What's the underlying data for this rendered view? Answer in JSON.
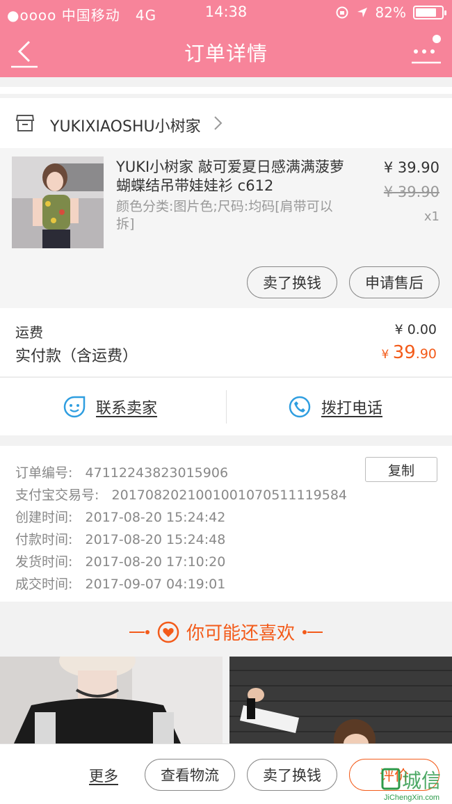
{
  "status_bar": {
    "signal": "●oooo 中国移动",
    "network": "4G",
    "time": "14:38",
    "battery": "82%"
  },
  "nav": {
    "title": "订单详情"
  },
  "shop": {
    "name": "YUKIXIAOSHU小树家"
  },
  "item": {
    "title": "YUKI小树家 敲可爱夏日感满满菠萝蝴蝶结吊带娃娃衫 c612",
    "spec": "颜色分类:图片色;尺码:均码[肩带可以拆]",
    "price": "¥ 39.90",
    "original_price": "¥ 39.90",
    "quantity": "x1",
    "actions": [
      "卖了换钱",
      "申请售后"
    ]
  },
  "fees": {
    "shipping_label": "运费",
    "shipping_value": "¥ 0.00",
    "paid_label": "实付款（含运费）",
    "paid_currency": "¥ ",
    "paid_int": "39",
    "paid_dec": ".90"
  },
  "contact": {
    "seller_label": "联系卖家",
    "call_label": "拨打电话"
  },
  "order_info": {
    "copy_label": "复制",
    "rows": [
      {
        "label": "订单编号:",
        "value": "47112243823015906"
      },
      {
        "label": "支付宝交易号:",
        "value": "2017082021001001070511119584"
      },
      {
        "label": "创建时间:",
        "value": "2017-08-20 15:24:42"
      },
      {
        "label": "付款时间:",
        "value": "2017-08-20 15:24:48"
      },
      {
        "label": "发货时间:",
        "value": "2017-08-20 17:10:20"
      },
      {
        "label": "成交时间:",
        "value": "2017-09-07 04:19:01"
      }
    ]
  },
  "recommend": {
    "title": "你可能还喜欢"
  },
  "bottom": {
    "more": "更多",
    "buttons": [
      "查看物流",
      "卖了换钱",
      "评价"
    ]
  },
  "watermark": {
    "brand": "城信",
    "url": "JiChengXin.com"
  },
  "colors": {
    "header": "#f7849a",
    "accent": "#f35b1a",
    "link_icon": "#2f9ee0"
  }
}
